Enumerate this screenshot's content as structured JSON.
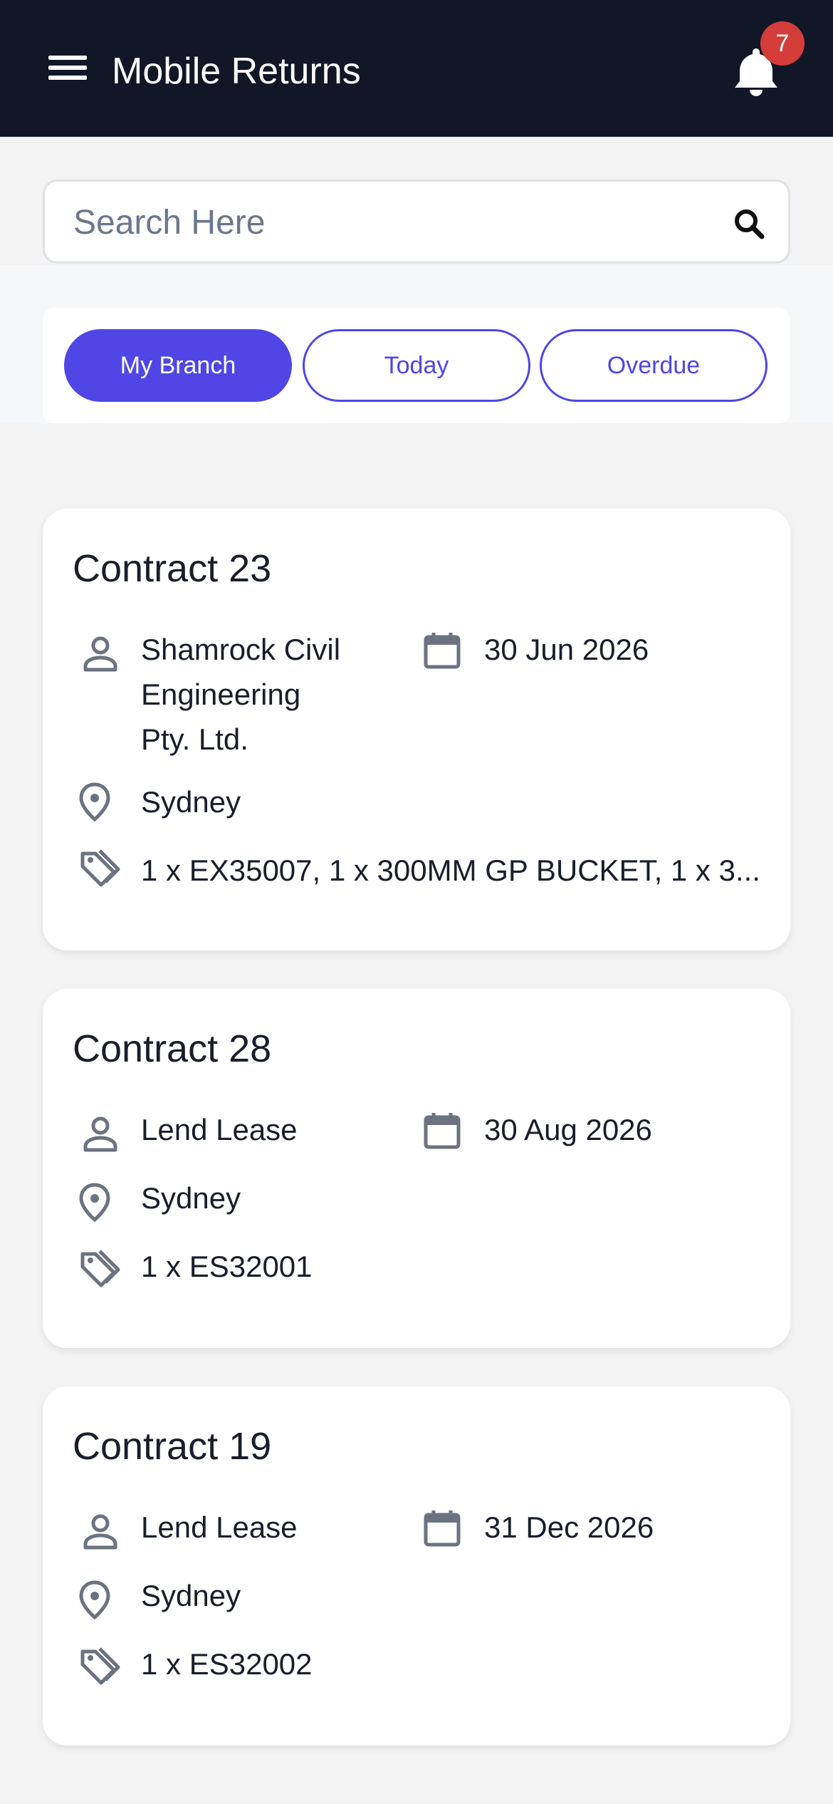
{
  "header": {
    "menu_icon": "hamburger-menu-icon",
    "title": "Mobile Returns",
    "bell_icon": "bell-icon",
    "notification_count": "7"
  },
  "search": {
    "placeholder": "Search Here",
    "value": "",
    "icon": "search-icon"
  },
  "filters": [
    {
      "label": "My Branch",
      "active": true
    },
    {
      "label": "Today",
      "active": false
    },
    {
      "label": "Overdue",
      "active": false
    }
  ],
  "colors": {
    "header_bg": "#111727",
    "accent": "#4f46e5",
    "badge": "#d43d3a",
    "icon_gray": "#6b7280"
  },
  "contracts": [
    {
      "title": "Contract 23",
      "customer": "Shamrock Civil Engineering Pty. Ltd.",
      "customer_lines": [
        "Shamrock Civil",
        "Engineering",
        "Pty. Ltd."
      ],
      "date": "30 Jun 2026",
      "location": "Sydney",
      "items": "1 x EX35007, 1 x 300MM GP BUCKET, 1 x 3..."
    },
    {
      "title": "Contract 28",
      "customer": "Lend Lease",
      "date": "30 Aug 2026",
      "location": "Sydney",
      "items": "1 x ES32001"
    },
    {
      "title": "Contract 19",
      "customer": "Lend Lease",
      "date": "31 Dec 2026",
      "location": "Sydney",
      "items": "1 x ES32002"
    }
  ]
}
